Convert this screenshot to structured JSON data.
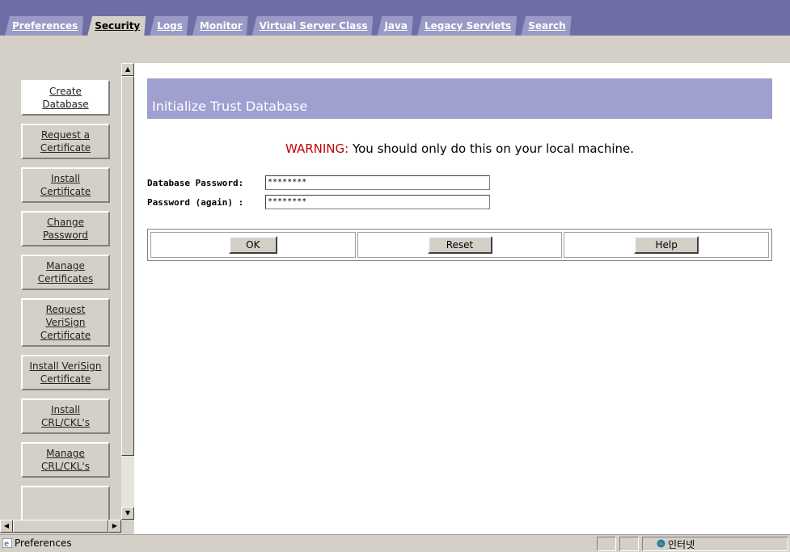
{
  "tabs": [
    {
      "label": "Preferences",
      "active": false
    },
    {
      "label": "Security",
      "active": true
    },
    {
      "label": "Logs",
      "active": false
    },
    {
      "label": "Monitor",
      "active": false
    },
    {
      "label": "Virtual Server Class",
      "active": false
    },
    {
      "label": "Java",
      "active": false
    },
    {
      "label": "Legacy Servlets",
      "active": false
    },
    {
      "label": "Search",
      "active": false
    }
  ],
  "sidebar": {
    "items": [
      {
        "label": "Create\nDatabase",
        "active": true
      },
      {
        "label": "Request a\nCertificate",
        "active": false
      },
      {
        "label": "Install\nCertificate",
        "active": false
      },
      {
        "label": "Change\nPassword",
        "active": false
      },
      {
        "label": "Manage\nCertificates",
        "active": false
      },
      {
        "label": "Request\nVeriSign\nCertificate",
        "active": false
      },
      {
        "label": "Install VeriSign\nCertificate",
        "active": false
      },
      {
        "label": "Install\nCRL/CKL's",
        "active": false
      },
      {
        "label": "Manage\nCRL/CKL's",
        "active": false
      }
    ]
  },
  "main": {
    "title": "Initialize Trust Database",
    "warning_label": "WARNING:",
    "warning_text": " You should only do this on your local machine.",
    "fields": [
      {
        "label": "Database Password:",
        "value": "********"
      },
      {
        "label": "Password (again) :",
        "value": "********"
      }
    ],
    "buttons": {
      "ok": "OK",
      "reset": "Reset",
      "help": "Help"
    }
  },
  "status": {
    "text": "Preferences",
    "zone": "인터넷"
  },
  "colors": {
    "tabbar": "#6e6ea6",
    "header": "#9f9fd0",
    "warning": "#c00000",
    "chrome": "#d4d0c8"
  }
}
